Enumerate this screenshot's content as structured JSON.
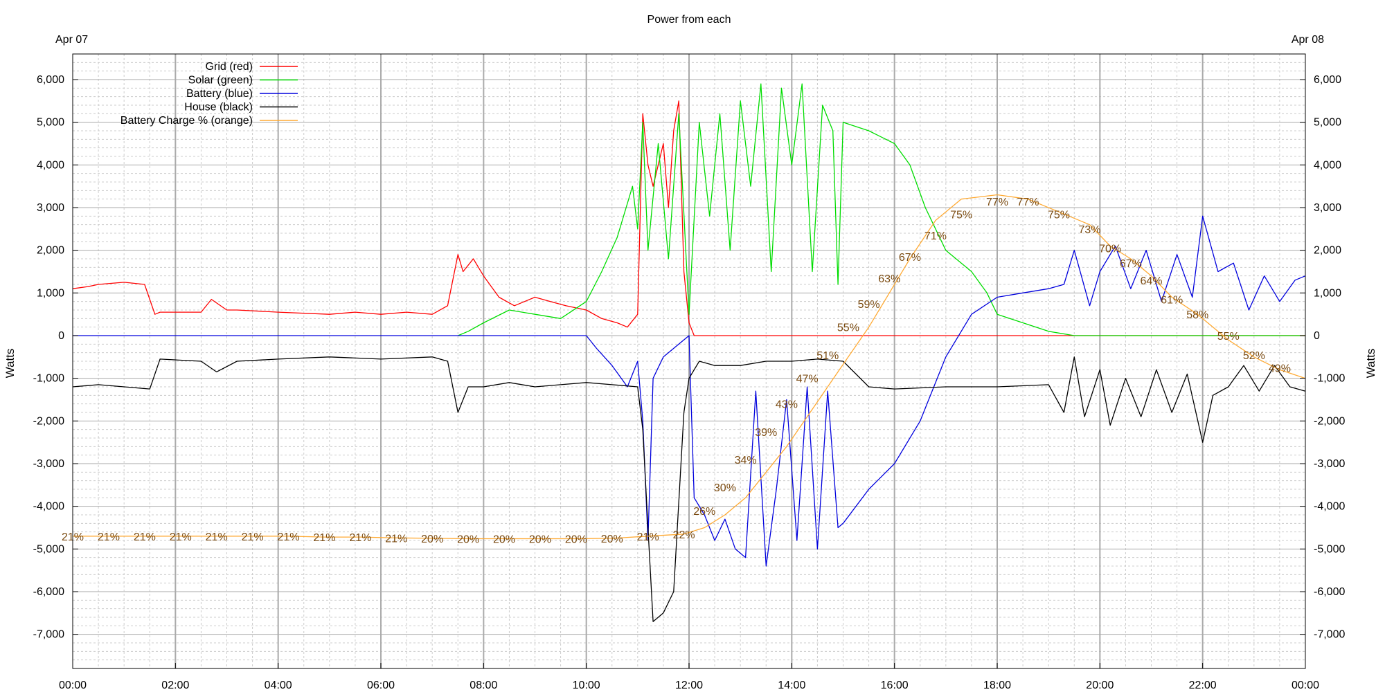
{
  "chart_data": {
    "type": "line",
    "title": "Power from each",
    "top_left_label": "Apr 07",
    "top_right_label": "Apr 08",
    "ylabel_left": "Watts",
    "ylabel_right": "Watts",
    "x_unit": "hours",
    "xlim": [
      0,
      24
    ],
    "ylim": [
      -7800,
      6600
    ],
    "x_ticks": [
      0,
      2,
      4,
      6,
      8,
      10,
      12,
      14,
      16,
      18,
      20,
      22,
      24
    ],
    "x_tick_labels": [
      "00:00",
      "02:00",
      "04:00",
      "06:00",
      "08:00",
      "10:00",
      "12:00",
      "14:00",
      "16:00",
      "18:00",
      "20:00",
      "22:00",
      "00:00"
    ],
    "y_ticks": [
      6000,
      5000,
      4000,
      3000,
      2000,
      1000,
      0,
      -1000,
      -2000,
      -3000,
      -4000,
      -5000,
      -6000,
      -7000
    ],
    "y_tick_labels": [
      "6,000",
      "5,000",
      "4,000",
      "3,000",
      "2,000",
      "1,000",
      "0",
      "-1,000",
      "-2,000",
      "-3,000",
      "-4,000",
      "-5,000",
      "-6,000",
      "-7,000"
    ],
    "grid": true,
    "legend_position": "top-left",
    "series": [
      {
        "name": "Grid (red)",
        "color": "#ff0000",
        "x": [
          0,
          0.3,
          0.5,
          1,
          1.4,
          1.6,
          1.7,
          2.5,
          2.7,
          3.0,
          3.2,
          4,
          5,
          5.5,
          6,
          6.5,
          7,
          7.3,
          7.5,
          7.6,
          7.8,
          8.0,
          8.3,
          8.6,
          9.0,
          9.3,
          9.6,
          10.0,
          10.3,
          10.6,
          10.8,
          11.0,
          11.1,
          11.2,
          11.3,
          11.5,
          11.6,
          11.7,
          11.8,
          11.9,
          12.0,
          12.1,
          13,
          15,
          18,
          21,
          24
        ],
        "y": [
          1100,
          1150,
          1200,
          1250,
          1200,
          500,
          550,
          550,
          850,
          600,
          600,
          550,
          500,
          550,
          500,
          550,
          500,
          700,
          1900,
          1500,
          1800,
          1400,
          900,
          700,
          900,
          800,
          700,
          600,
          400,
          300,
          200,
          500,
          5200,
          4000,
          3500,
          4500,
          3000,
          4800,
          5500,
          1500,
          300,
          0,
          0,
          0,
          0,
          0,
          0
        ]
      },
      {
        "name": "Solar (green)",
        "color": "#00dd00",
        "x": [
          7.5,
          7.7,
          8.0,
          8.5,
          9.0,
          9.5,
          10.0,
          10.3,
          10.6,
          10.9,
          11.0,
          11.1,
          11.2,
          11.4,
          11.6,
          11.8,
          12.0,
          12.2,
          12.4,
          12.6,
          12.8,
          13.0,
          13.2,
          13.4,
          13.6,
          13.8,
          14.0,
          14.2,
          14.4,
          14.6,
          14.8,
          14.9,
          15.0,
          15.5,
          16.0,
          16.3,
          16.6,
          17.0,
          17.5,
          17.8,
          18.0,
          18.5,
          19.0,
          19.5,
          20,
          22,
          24
        ],
        "y": [
          0,
          100,
          300,
          600,
          500,
          400,
          800,
          1500,
          2300,
          3500,
          2500,
          5000,
          2000,
          4500,
          1800,
          5200,
          500,
          5000,
          2800,
          5200,
          2000,
          5500,
          3500,
          5900,
          1500,
          5800,
          4000,
          5900,
          1500,
          5400,
          4800,
          1200,
          5000,
          4800,
          4500,
          4000,
          3000,
          2000,
          1500,
          1000,
          500,
          300,
          100,
          0,
          0,
          0,
          0
        ]
      },
      {
        "name": "Battery (blue)",
        "color": "#0000dd",
        "x": [
          0,
          10.0,
          10.2,
          10.5,
          10.8,
          11.0,
          11.1,
          11.2,
          11.3,
          11.5,
          11.8,
          12.0,
          12.1,
          12.3,
          12.5,
          12.7,
          12.9,
          13.1,
          13.3,
          13.5,
          13.7,
          13.9,
          14.1,
          14.3,
          14.5,
          14.7,
          14.9,
          15.0,
          15.5,
          16.0,
          16.5,
          17.0,
          17.5,
          18.0,
          18.5,
          19.0,
          19.3,
          19.5,
          19.8,
          20.0,
          20.3,
          20.6,
          20.9,
          21.2,
          21.5,
          21.8,
          22.0,
          22.3,
          22.6,
          22.9,
          23.2,
          23.5,
          23.8,
          24.0
        ],
        "y": [
          0,
          0,
          -300,
          -700,
          -1200,
          -600,
          -2000,
          -4800,
          -1000,
          -500,
          -200,
          0,
          -3800,
          -4200,
          -4800,
          -4300,
          -5000,
          -5200,
          -1300,
          -5400,
          -3600,
          -1500,
          -4800,
          -1200,
          -5000,
          -1300,
          -4500,
          -4400,
          -3600,
          -3000,
          -2000,
          -500,
          500,
          900,
          1000,
          1100,
          1200,
          2000,
          700,
          1500,
          2100,
          1100,
          2000,
          800,
          1900,
          900,
          2800,
          1500,
          1700,
          600,
          1400,
          800,
          1300,
          1400
        ]
      },
      {
        "name": "House (black)",
        "color": "#000000",
        "x": [
          0,
          0.5,
          1,
          1.5,
          1.7,
          2.5,
          2.8,
          3.2,
          4,
          5,
          6,
          7,
          7.3,
          7.5,
          7.7,
          8.0,
          8.5,
          9.0,
          9.5,
          10.0,
          10.5,
          11.0,
          11.1,
          11.2,
          11.3,
          11.5,
          11.7,
          11.9,
          12.0,
          12.2,
          12.5,
          13,
          13.5,
          14,
          14.5,
          15.0,
          15.5,
          16,
          17,
          18,
          19,
          19.3,
          19.5,
          19.7,
          20,
          20.2,
          20.5,
          20.8,
          21.1,
          21.4,
          21.7,
          22.0,
          22.2,
          22.5,
          22.8,
          23.1,
          23.4,
          23.7,
          24.0
        ],
        "y": [
          -1200,
          -1150,
          -1200,
          -1250,
          -550,
          -600,
          -850,
          -600,
          -550,
          -500,
          -550,
          -500,
          -600,
          -1800,
          -1200,
          -1200,
          -1100,
          -1200,
          -1150,
          -1100,
          -1150,
          -1200,
          -2200,
          -4500,
          -6700,
          -6500,
          -6000,
          -1800,
          -1000,
          -600,
          -700,
          -700,
          -600,
          -600,
          -550,
          -600,
          -1200,
          -1250,
          -1200,
          -1200,
          -1150,
          -1800,
          -500,
          -1900,
          -800,
          -2100,
          -1000,
          -1900,
          -800,
          -1800,
          -900,
          -2500,
          -1400,
          -1200,
          -700,
          -1300,
          -700,
          -1200,
          -1300
        ]
      },
      {
        "name": "Battery Charge % (orange)",
        "color": "#ffaa33",
        "x": [
          0,
          0.7,
          1.4,
          2.1,
          2.8,
          3.5,
          4.2,
          4.9,
          5.6,
          6.3,
          7.0,
          7.7,
          8.4,
          9.1,
          9.8,
          10.5,
          11.2,
          11.9,
          12.3,
          12.7,
          13.1,
          13.5,
          13.9,
          14.3,
          14.7,
          15.1,
          15.5,
          15.9,
          16.3,
          16.8,
          17.3,
          18.0,
          18.6,
          19.2,
          19.8,
          20.2,
          20.6,
          21.0,
          21.4,
          21.9,
          22.5,
          23.0,
          23.5,
          24.0
        ],
        "y": [
          -4700,
          -4700,
          -4700,
          -4700,
          -4700,
          -4700,
          -4700,
          -4720,
          -4720,
          -4740,
          -4750,
          -4760,
          -4760,
          -4760,
          -4760,
          -4750,
          -4700,
          -4650,
          -4500,
          -4200,
          -3800,
          -3200,
          -2600,
          -1900,
          -1200,
          -500,
          200,
          1000,
          1800,
          2700,
          3200,
          3300,
          3200,
          2900,
          2600,
          2100,
          1800,
          1400,
          900,
          500,
          -100,
          -500,
          -800,
          -1000
        ]
      }
    ],
    "annotations": [
      {
        "x": 0.0,
        "y": -4700,
        "text": "21%"
      },
      {
        "x": 0.7,
        "y": -4700,
        "text": "21%"
      },
      {
        "x": 1.4,
        "y": -4700,
        "text": "21%"
      },
      {
        "x": 2.1,
        "y": -4700,
        "text": "21%"
      },
      {
        "x": 2.8,
        "y": -4700,
        "text": "21%"
      },
      {
        "x": 3.5,
        "y": -4700,
        "text": "21%"
      },
      {
        "x": 4.2,
        "y": -4700,
        "text": "21%"
      },
      {
        "x": 4.9,
        "y": -4720,
        "text": "21%"
      },
      {
        "x": 5.6,
        "y": -4720,
        "text": "21%"
      },
      {
        "x": 6.3,
        "y": -4740,
        "text": "21%"
      },
      {
        "x": 7.0,
        "y": -4750,
        "text": "20%"
      },
      {
        "x": 7.7,
        "y": -4760,
        "text": "20%"
      },
      {
        "x": 8.4,
        "y": -4760,
        "text": "20%"
      },
      {
        "x": 9.1,
        "y": -4760,
        "text": "20%"
      },
      {
        "x": 9.8,
        "y": -4760,
        "text": "20%"
      },
      {
        "x": 10.5,
        "y": -4750,
        "text": "20%"
      },
      {
        "x": 11.2,
        "y": -4700,
        "text": "21%"
      },
      {
        "x": 11.9,
        "y": -4650,
        "text": "22%"
      },
      {
        "x": 12.3,
        "y": -4100,
        "text": "26%"
      },
      {
        "x": 12.7,
        "y": -3550,
        "text": "30%"
      },
      {
        "x": 13.1,
        "y": -2900,
        "text": "34%"
      },
      {
        "x": 13.5,
        "y": -2250,
        "text": "39%"
      },
      {
        "x": 13.9,
        "y": -1600,
        "text": "43%"
      },
      {
        "x": 14.3,
        "y": -1000,
        "text": "47%"
      },
      {
        "x": 14.7,
        "y": -450,
        "text": "51%"
      },
      {
        "x": 15.1,
        "y": 200,
        "text": "55%"
      },
      {
        "x": 15.5,
        "y": 750,
        "text": "59%"
      },
      {
        "x": 15.9,
        "y": 1350,
        "text": "63%"
      },
      {
        "x": 16.3,
        "y": 1850,
        "text": "67%"
      },
      {
        "x": 16.8,
        "y": 2350,
        "text": "71%"
      },
      {
        "x": 17.3,
        "y": 2850,
        "text": "75%"
      },
      {
        "x": 18.0,
        "y": 3150,
        "text": "77%"
      },
      {
        "x": 18.6,
        "y": 3150,
        "text": "77%"
      },
      {
        "x": 19.2,
        "y": 2850,
        "text": "75%"
      },
      {
        "x": 19.8,
        "y": 2500,
        "text": "73%"
      },
      {
        "x": 20.2,
        "y": 2050,
        "text": "70%"
      },
      {
        "x": 20.6,
        "y": 1700,
        "text": "67%"
      },
      {
        "x": 21.0,
        "y": 1300,
        "text": "64%"
      },
      {
        "x": 21.4,
        "y": 850,
        "text": "61%"
      },
      {
        "x": 21.9,
        "y": 500,
        "text": "58%"
      },
      {
        "x": 22.5,
        "y": 0,
        "text": "55%"
      },
      {
        "x": 23.0,
        "y": -450,
        "text": "52%"
      },
      {
        "x": 23.5,
        "y": -750,
        "text": "49%"
      }
    ]
  }
}
